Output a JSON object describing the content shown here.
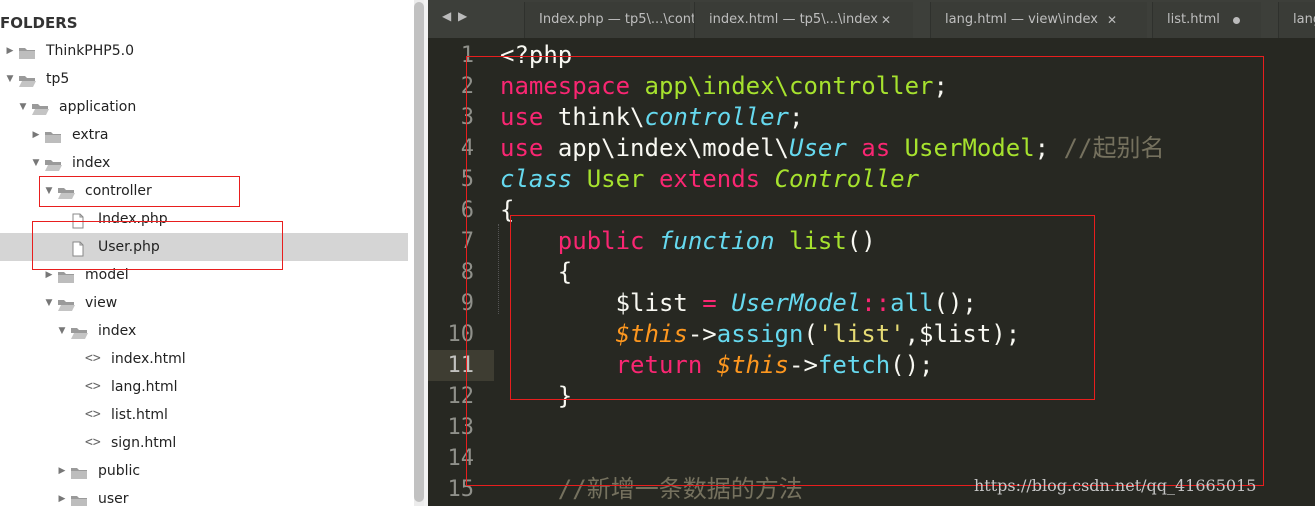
{
  "sidebar": {
    "header": "FOLDERS",
    "tree": [
      {
        "label": "ThinkPHP5.0",
        "type": "folder",
        "expanded": false
      },
      {
        "label": "tp5",
        "type": "folder",
        "expanded": true
      },
      {
        "label": "application",
        "type": "folder",
        "expanded": true
      },
      {
        "label": "extra",
        "type": "folder",
        "expanded": false
      },
      {
        "label": "index",
        "type": "folder",
        "expanded": true
      },
      {
        "label": "controller",
        "type": "folder",
        "expanded": true
      },
      {
        "label": "Index.php",
        "type": "file"
      },
      {
        "label": "User.php",
        "type": "file",
        "selected": true
      },
      {
        "label": "model",
        "type": "folder",
        "expanded": false
      },
      {
        "label": "view",
        "type": "folder",
        "expanded": true
      },
      {
        "label": "index",
        "type": "folder",
        "expanded": true
      },
      {
        "label": "index.html",
        "type": "code-file"
      },
      {
        "label": "lang.html",
        "type": "code-file"
      },
      {
        "label": "list.html",
        "type": "code-file"
      },
      {
        "label": "sign.html",
        "type": "code-file"
      },
      {
        "label": "public",
        "type": "folder",
        "expanded": false
      },
      {
        "label": "user",
        "type": "folder",
        "expanded": false
      }
    ]
  },
  "tabs": [
    {
      "label": "Index.php — tp5\\...\\cont"
    },
    {
      "label": "index.html — tp5\\...\\index",
      "close": "✕"
    },
    {
      "label": "lang.html — view\\index",
      "close": "✕"
    },
    {
      "label": "list.html",
      "dirty": true
    },
    {
      "label": "lang"
    }
  ],
  "editor": {
    "line_numbers": [
      "1",
      "2",
      "3",
      "4",
      "5",
      "6",
      "7",
      "8",
      "9",
      "10",
      "11",
      "12",
      "13",
      "14",
      "15"
    ],
    "active_line": "11",
    "code": {
      "l1": "<?php",
      "l2_kw": "namespace",
      "l2_ns": "app\\index\\controller",
      "l2_end": ";",
      "l3_kw": "use",
      "l3_a": "think\\",
      "l3_b": "controller",
      "l3_end": ";",
      "l4_kw": "use",
      "l4_a": "app\\index\\model\\",
      "l4_b": "User",
      "l4_as": "as",
      "l4_alias": "UserModel",
      "l4_end": ";",
      "l4_comment": "//起别名",
      "l5_class": "class",
      "l5_name": "User",
      "l5_extends": "extends",
      "l5_parent": "Controller",
      "l6": "{",
      "l7_public": "public",
      "l7_function": "function",
      "l7_name": "list",
      "l7_paren": "()",
      "l8": "{",
      "l9_var": "$list",
      "l9_eq": "=",
      "l9_cls": "UserModel",
      "l9_op": "::",
      "l9_fn": "all",
      "l9_end": "();",
      "l10_this": "$this",
      "l10_arrow": "->",
      "l10_fn": "assign",
      "l10_open": "(",
      "l10_str": "'list'",
      "l10_rest": ",$list);",
      "l11_return": "return",
      "l11_this": "$this",
      "l11_arrow": "->",
      "l11_fn": "fetch",
      "l11_end": "();",
      "l12": "}",
      "l15_comment": "//新增一条数据的方法"
    }
  },
  "watermark": "https://blog.csdn.net/qq_41665015",
  "colors": {
    "editor_bg": "#272822",
    "keyword": "#f92672",
    "namespace": "#a6e22e",
    "italic_type": "#66d9ef",
    "this_var": "#fd971f",
    "string": "#e6db74",
    "comment": "#75715e",
    "highlight_box": "#e81e1e"
  }
}
